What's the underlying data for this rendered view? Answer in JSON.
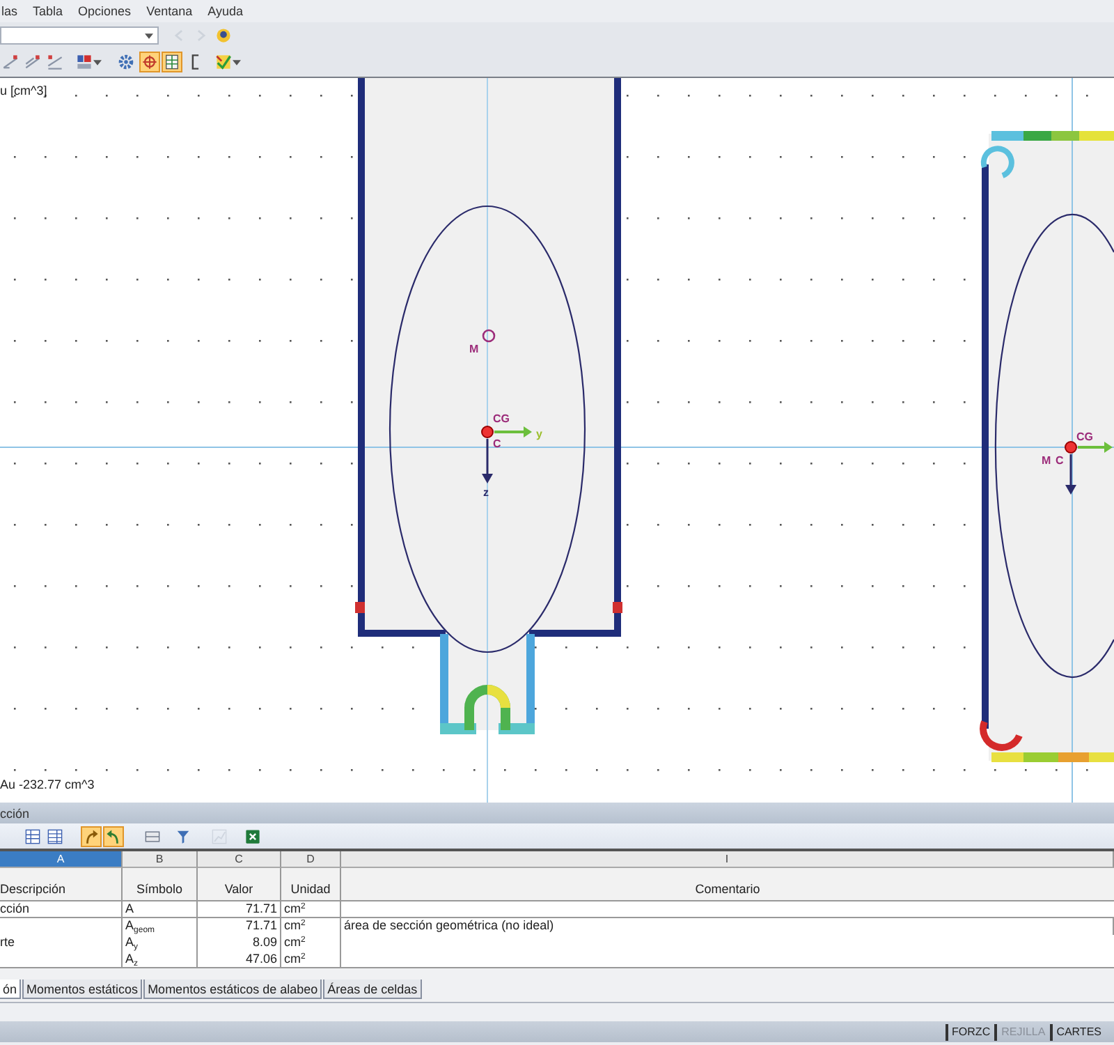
{
  "menu_bar": [
    {
      "label": "las"
    },
    {
      "label": "Tabla"
    },
    {
      "label": "Opciones"
    },
    {
      "label": "Ventana"
    },
    {
      "label": "Ayuda"
    }
  ],
  "toolbar_1": {
    "buttons": [
      {
        "disabled": true
      },
      {
        "disabled": true
      },
      {
        "disabled": false
      }
    ]
  },
  "toolbar_2": {
    "buttons": [
      {
        "selected": false,
        "dropdown": false
      },
      {
        "selected": false,
        "dropdown": false
      },
      {
        "selected": false,
        "dropdown": false
      },
      {
        "selected": false,
        "dropdown": true
      },
      {
        "selected": false,
        "dropdown": false
      },
      {
        "selected": true,
        "dropdown": false
      },
      {
        "selected": true,
        "dropdown": false
      },
      {
        "selected": false,
        "dropdown": false
      },
      {
        "selected": false,
        "dropdown": true
      }
    ]
  },
  "canvas": {
    "title": "u [cm^3]",
    "extreme_label": "Au -232.77 cm^3",
    "left_section": {
      "labels": [
        "M",
        "CG",
        "C",
        "y",
        "z"
      ]
    },
    "right_section": {
      "labels": [
        "CG",
        "M",
        "C"
      ]
    }
  },
  "panel": {
    "title": "cción",
    "toolbar": {
      "buttons": [
        {
          "selected": false,
          "disabled": false
        },
        {
          "selected": false,
          "disabled": false
        },
        {
          "selected": true,
          "disabled": false
        },
        {
          "selected": true,
          "disabled": false
        },
        {
          "selected": false,
          "disabled": false
        },
        {
          "selected": false,
          "disabled": false
        },
        {
          "selected": false,
          "disabled": true
        },
        {
          "selected": false,
          "disabled": false
        }
      ]
    },
    "table": {
      "columns": [
        {
          "letter": "A",
          "title": "Descripción",
          "selected": true
        },
        {
          "letter": "B",
          "title": "Símbolo",
          "selected": false
        },
        {
          "letter": "C",
          "title": "Valor",
          "selected": false
        },
        {
          "letter": "D",
          "title": "Unidad",
          "selected": false
        },
        {
          "letter": "I",
          "title": "Comentario",
          "selected": false
        }
      ],
      "rows": [
        {
          "description": "cción",
          "lines": [
            {
              "symbol": "A",
              "value": "71.71",
              "unit": "cm$^{2}$"
            }
          ]
        },
        {
          "description": "rte",
          "lines": [
            {
              "symbol": "A$_{geom}$",
              "value": "71.71",
              "unit": "cm$^{2}$",
              "comment": "área de sección geométrica (no ideal)"
            },
            {
              "symbol": "A$_{y}$",
              "value": "8.09",
              "unit": "cm$^{2}$"
            },
            {
              "symbol": "A$_{z}$",
              "value": "47.06",
              "unit": "cm$^{2}$"
            }
          ]
        }
      ]
    },
    "tabs": [
      {
        "label": "ón",
        "selected": true
      },
      {
        "label": "Momentos estáticos",
        "selected": false
      },
      {
        "label": "Momentos estáticos de alabeo",
        "selected": false
      },
      {
        "label": "Áreas de celdas",
        "selected": false
      }
    ]
  },
  "status_bar": [
    {
      "label": "FORZC",
      "on": true
    },
    {
      "label": "REJILLA",
      "on": false
    },
    {
      "label": "CARTES",
      "on": true
    }
  ]
}
